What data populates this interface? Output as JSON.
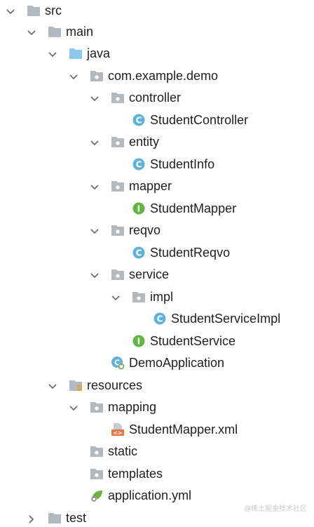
{
  "tree": [
    {
      "label": "src",
      "icon": "folder-icon",
      "arrow": "expanded"
    },
    {
      "label": "main",
      "icon": "folder-icon",
      "arrow": "expanded"
    },
    {
      "label": "java",
      "icon": "source-folder-icon",
      "arrow": "expanded"
    },
    {
      "label": "com.example.demo",
      "icon": "package-icon",
      "arrow": "expanded"
    },
    {
      "label": "controller",
      "icon": "package-icon",
      "arrow": "expanded"
    },
    {
      "label": "StudentController",
      "icon": "class-icon",
      "arrow": "none"
    },
    {
      "label": "entity",
      "icon": "package-icon",
      "arrow": "expanded"
    },
    {
      "label": "StudentInfo",
      "icon": "class-icon",
      "arrow": "none"
    },
    {
      "label": "mapper",
      "icon": "package-icon",
      "arrow": "expanded"
    },
    {
      "label": "StudentMapper",
      "icon": "interface-icon",
      "arrow": "none"
    },
    {
      "label": "reqvo",
      "icon": "package-icon",
      "arrow": "expanded"
    },
    {
      "label": "StudentReqvo",
      "icon": "class-icon",
      "arrow": "none"
    },
    {
      "label": "service",
      "icon": "package-icon",
      "arrow": "expanded"
    },
    {
      "label": "impl",
      "icon": "package-icon",
      "arrow": "expanded"
    },
    {
      "label": "StudentServiceImpl",
      "icon": "class-icon",
      "arrow": "none"
    },
    {
      "label": "StudentService",
      "icon": "interface-icon",
      "arrow": "none"
    },
    {
      "label": "DemoApplication",
      "icon": "spring-boot-class-icon",
      "arrow": "none"
    },
    {
      "label": "resources",
      "icon": "resources-folder-icon",
      "arrow": "expanded"
    },
    {
      "label": "mapping",
      "icon": "package-icon",
      "arrow": "expanded"
    },
    {
      "label": "StudentMapper.xml",
      "icon": "xml-file-icon",
      "arrow": "none"
    },
    {
      "label": "static",
      "icon": "package-icon",
      "arrow": "none"
    },
    {
      "label": "templates",
      "icon": "package-icon",
      "arrow": "none"
    },
    {
      "label": "application.yml",
      "icon": "yaml-spring-icon",
      "arrow": "none"
    },
    {
      "label": "test",
      "icon": "folder-icon",
      "arrow": "collapsed"
    }
  ],
  "watermark": "@稀土掘金技术社区",
  "colors": {
    "folder": "#b4b9bf",
    "source_folder": "#89c9ed",
    "class": "#5fb3d9",
    "interface": "#62b543",
    "arrow": "#6e6e6e",
    "text": "#1f1f1f"
  }
}
